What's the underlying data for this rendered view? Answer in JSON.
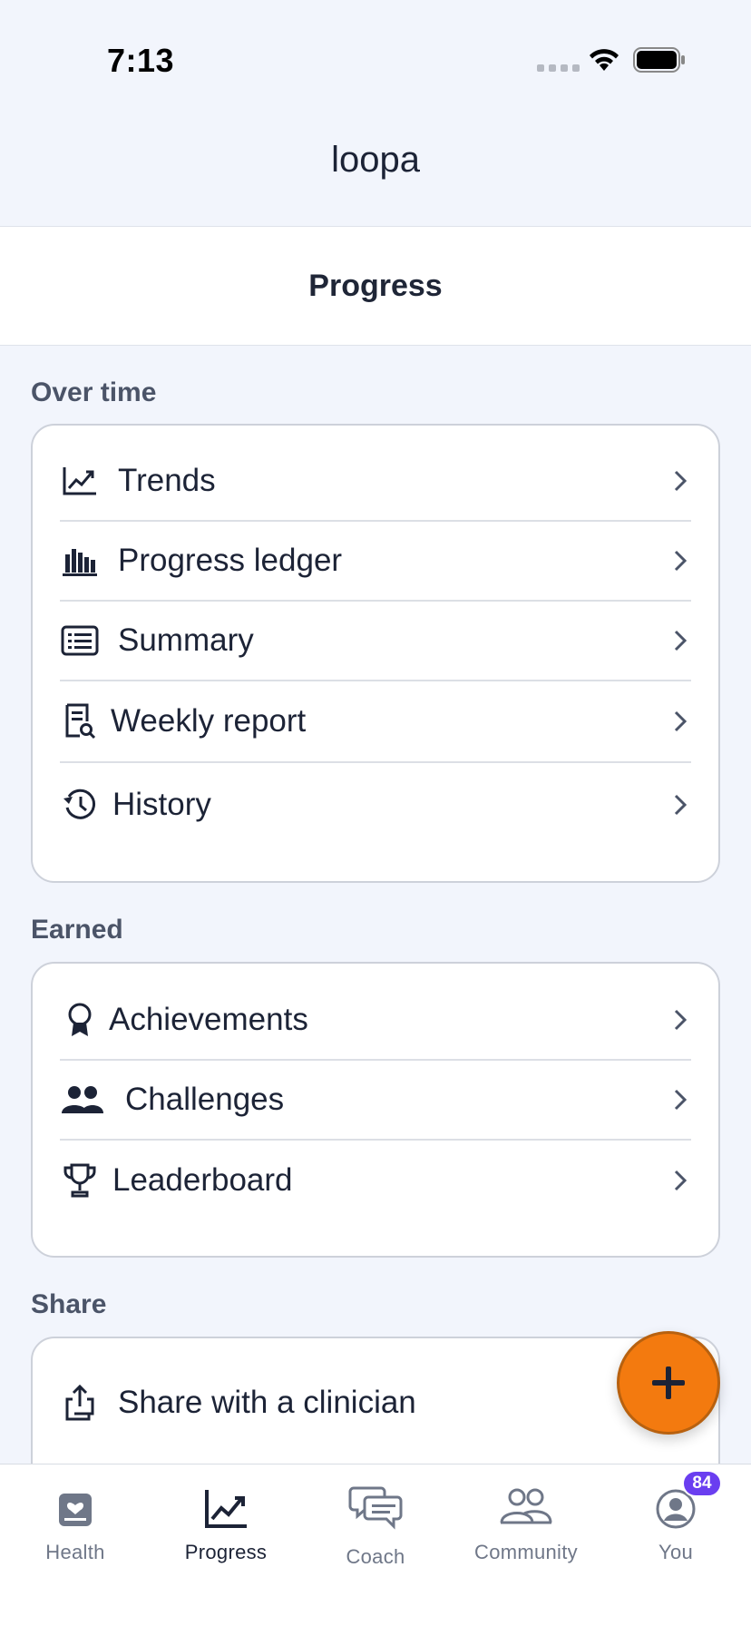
{
  "status": {
    "time": "7:13"
  },
  "header": {
    "logo_text": "loopa",
    "title": "Progress"
  },
  "sections": [
    {
      "label": "Over time",
      "items": [
        {
          "label": "Trends",
          "icon": "trend-chart-icon"
        },
        {
          "label": "Progress ledger",
          "icon": "bar-chart-icon"
        },
        {
          "label": "Summary",
          "icon": "list-document-icon"
        },
        {
          "label": "Weekly report",
          "icon": "report-search-icon"
        },
        {
          "label": "History",
          "icon": "history-clock-icon"
        }
      ]
    },
    {
      "label": "Earned",
      "items": [
        {
          "label": "Achievements",
          "icon": "award-ribbon-icon"
        },
        {
          "label": "Challenges",
          "icon": "people-icon"
        },
        {
          "label": "Leaderboard",
          "icon": "trophy-icon"
        }
      ]
    },
    {
      "label": "Share",
      "items": [
        {
          "label": "Share with a clinician",
          "icon": "share-icon"
        }
      ]
    }
  ],
  "tabs": [
    {
      "label": "Health",
      "icon": "health-card-icon",
      "active": false
    },
    {
      "label": "Progress",
      "icon": "trend-chart-icon",
      "active": true
    },
    {
      "label": "Coach",
      "icon": "chat-bubbles-icon",
      "active": false
    },
    {
      "label": "Community",
      "icon": "community-people-icon",
      "active": false
    },
    {
      "label": "You",
      "icon": "user-avatar-icon",
      "active": false
    }
  ],
  "badge": {
    "you_count": "84"
  },
  "colors": {
    "accent_fab": "#f37a0f",
    "badge": "#6a3ef0",
    "background": "#f2f5fc"
  }
}
